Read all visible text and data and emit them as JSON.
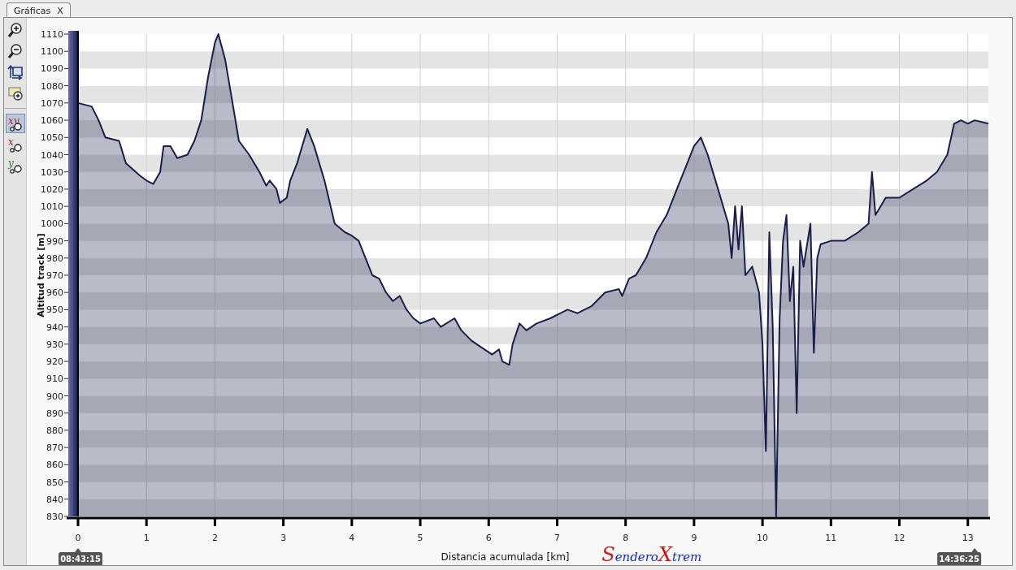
{
  "tabs": [
    {
      "label": "Gráficas",
      "close": "X",
      "selected": true
    }
  ],
  "toolbar": [
    {
      "kind": "zoom_in",
      "selected": false
    },
    {
      "kind": "zoom_out",
      "selected": false
    },
    {
      "kind": "reset",
      "selected": false
    },
    {
      "kind": "note",
      "selected": false
    },
    {
      "kind": "axis",
      "label": "xy",
      "selected": true
    },
    {
      "kind": "axis",
      "label": "x",
      "selected": false
    },
    {
      "kind": "axis",
      "label": "y",
      "selected": false
    }
  ],
  "chart": {
    "start_time": "08:43:15",
    "end_time": "14:36:25",
    "logo": [
      {
        "text": "S",
        "kind": "initial"
      },
      {
        "text": "endero",
        "kind": "rest"
      },
      {
        "text": "X",
        "kind": "initial"
      },
      {
        "text": "trem",
        "kind": "rest"
      }
    ],
    "chart_data": {
      "type": "area",
      "xlabel": "Distancia acumulada [km]",
      "ylabel": "Altitud track [m]",
      "x": [
        0,
        0.2,
        0.3,
        0.4,
        0.6,
        0.7,
        0.9,
        1.0,
        1.1,
        1.2,
        1.25,
        1.35,
        1.45,
        1.6,
        1.7,
        1.8,
        1.9,
        2.0,
        2.05,
        2.15,
        2.3,
        2.35,
        2.5,
        2.65,
        2.75,
        2.8,
        2.9,
        2.95,
        3.05,
        3.1,
        3.2,
        3.35,
        3.45,
        3.6,
        3.75,
        3.9,
        4.0,
        4.1,
        4.2,
        4.3,
        4.4,
        4.5,
        4.6,
        4.7,
        4.8,
        4.9,
        5.0,
        5.2,
        5.3,
        5.5,
        5.6,
        5.75,
        5.9,
        6.05,
        6.15,
        6.2,
        6.3,
        6.35,
        6.45,
        6.55,
        6.7,
        6.9,
        7.05,
        7.15,
        7.3,
        7.5,
        7.7,
        7.9,
        7.95,
        8.05,
        8.15,
        8.3,
        8.45,
        8.6,
        8.75,
        8.9,
        9.0,
        9.1,
        9.2,
        9.35,
        9.5,
        9.55,
        9.6,
        9.65,
        9.7,
        9.75,
        9.85,
        9.95,
        10.0,
        10.05,
        10.1,
        10.15,
        10.2,
        10.25,
        10.3,
        10.35,
        10.4,
        10.45,
        10.5,
        10.55,
        10.6,
        10.7,
        10.75,
        10.8,
        10.85,
        11.0,
        11.2,
        11.4,
        11.55,
        11.6,
        11.65,
        11.8,
        12.0,
        12.2,
        12.4,
        12.55,
        12.7,
        12.8,
        12.9,
        13.0,
        13.1,
        13.3
      ],
      "grid": true,
      "series": [
        {
          "color": "#1a1f4a",
          "values": [
            1070,
            1068,
            1060,
            1050,
            1048,
            1035,
            1028,
            1025,
            1023,
            1030,
            1045,
            1045,
            1038,
            1040,
            1048,
            1060,
            1085,
            1105,
            1110,
            1095,
            1060,
            1048,
            1040,
            1030,
            1022,
            1025,
            1020,
            1012,
            1015,
            1025,
            1035,
            1055,
            1045,
            1025,
            1000,
            995,
            993,
            990,
            980,
            970,
            968,
            960,
            955,
            958,
            950,
            945,
            942,
            945,
            940,
            945,
            938,
            932,
            928,
            924,
            927,
            920,
            918,
            930,
            942,
            938,
            942,
            945,
            948,
            950,
            948,
            952,
            960,
            962,
            958,
            968,
            970,
            980,
            995,
            1005,
            1020,
            1035,
            1045,
            1050,
            1040,
            1020,
            1000,
            980,
            1010,
            985,
            1010,
            970,
            975,
            960,
            930,
            868,
            995,
            940,
            830,
            945,
            990,
            1005,
            955,
            975,
            890,
            990,
            975,
            1000,
            925,
            980,
            988,
            990,
            990,
            995,
            1000,
            1030,
            1005,
            1015,
            1015,
            1020,
            1025,
            1030,
            1040,
            1058,
            1060,
            1058,
            1060,
            1058
          ]
        }
      ],
      "xlim": [
        0,
        13.3
      ],
      "ylim": [
        830,
        1110
      ],
      "xticks": [
        0,
        1,
        2,
        3,
        4,
        5,
        6,
        7,
        8,
        9,
        10,
        11,
        12,
        13
      ],
      "yticks": [
        830,
        840,
        850,
        860,
        870,
        880,
        890,
        900,
        910,
        920,
        930,
        940,
        950,
        960,
        970,
        980,
        990,
        1000,
        1010,
        1020,
        1030,
        1040,
        1050,
        1060,
        1070,
        1080,
        1090,
        1100,
        1110
      ]
    }
  }
}
